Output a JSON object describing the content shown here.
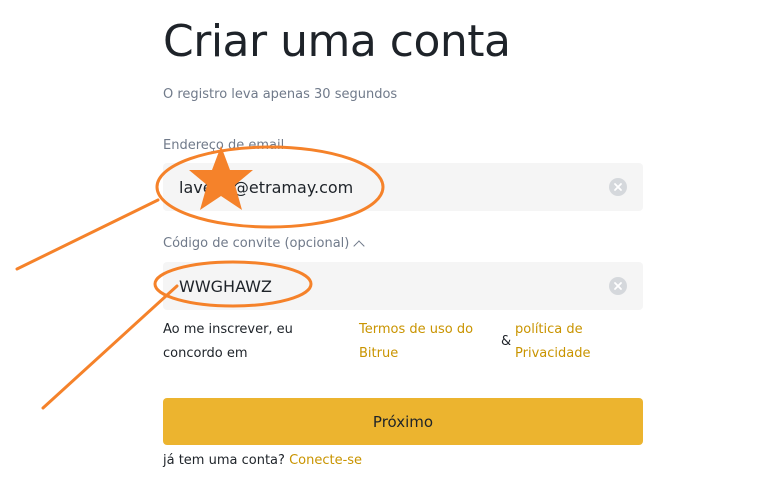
{
  "form": {
    "title": "Criar uma conta",
    "subtitle": "O registro leva apenas 30 segundos",
    "email_label": "Endereço de email",
    "email_value": "lave‍‍44@etramay.com",
    "invite_label": "Código de convite (opcional)",
    "invite_value": "WWGHAWZ",
    "terms_text": "Ao me inscrever, eu concordo em",
    "terms_link": "Termos de uso do Bitrue",
    "ampersand": "&",
    "privacy_link": "política de Privacidade",
    "next_button": "Próximo",
    "login_prompt": "já tem uma conta?",
    "login_link": "Conecte-se"
  },
  "colors": {
    "accent": "#ecb42f",
    "link": "#c99400",
    "annotation": "#f5822a"
  },
  "icons": {
    "clear": "clear-circle-icon",
    "chevron": "chevron-up-icon",
    "annotation_star": "star-annotation"
  }
}
